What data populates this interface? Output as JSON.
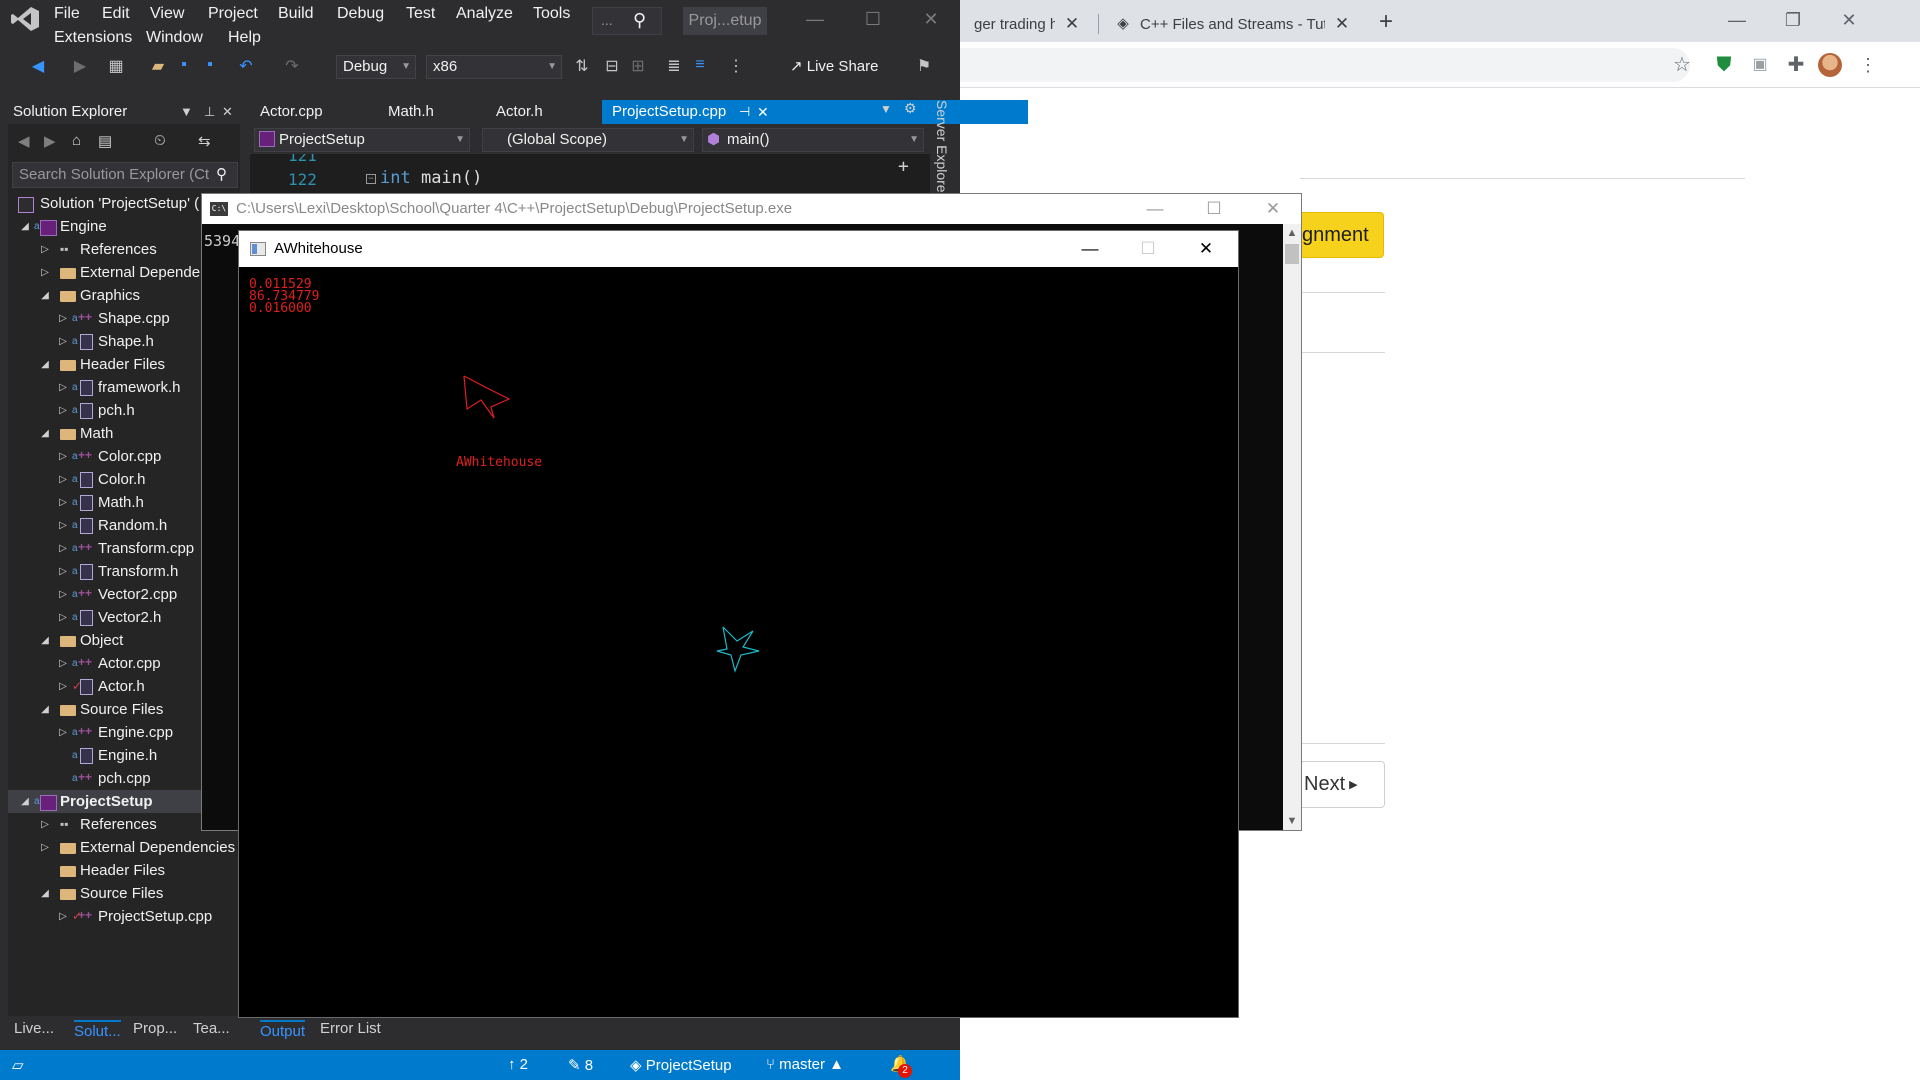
{
  "browser": {
    "tabs": [
      {
        "title": "ger trading ha",
        "close": "✕"
      },
      {
        "title": "C++ Files and Streams - Tutorials",
        "close": "✕"
      }
    ],
    "new_tab": "+",
    "page": {
      "assignment_button": "gnment",
      "next_button": "Next"
    }
  },
  "vs": {
    "menu": [
      "File",
      "Edit",
      "View",
      "Project",
      "Build",
      "Debug",
      "Test",
      "Analyze",
      "Tools",
      "Extensions",
      "Window",
      "Help"
    ],
    "search_placeholder": "...",
    "project_title": "Proj...etup",
    "toolbar": {
      "configuration": "Debug",
      "platform": "x86",
      "live_share": "Live Share"
    },
    "solution_explorer": {
      "title": "Solution Explorer",
      "search_placeholder": "Search Solution Explorer (Ct",
      "solution_label": "Solution 'ProjectSetup' (",
      "tree": [
        {
          "label": "Engine",
          "level": 1,
          "kind": "project",
          "expanded": true
        },
        {
          "label": "References",
          "level": 2,
          "kind": "ref",
          "expanded": false
        },
        {
          "label": "External Depende",
          "level": 2,
          "kind": "folder",
          "expanded": false
        },
        {
          "label": "Graphics",
          "level": 2,
          "kind": "folder",
          "expanded": true
        },
        {
          "label": "Shape.cpp",
          "level": 3,
          "kind": "cpp",
          "expanded": false
        },
        {
          "label": "Shape.h",
          "level": 3,
          "kind": "h",
          "expanded": false
        },
        {
          "label": "Header Files",
          "level": 2,
          "kind": "folder",
          "expanded": true
        },
        {
          "label": "framework.h",
          "level": 3,
          "kind": "h",
          "expanded": false
        },
        {
          "label": "pch.h",
          "level": 3,
          "kind": "h",
          "expanded": false
        },
        {
          "label": "Math",
          "level": 2,
          "kind": "folder",
          "expanded": true
        },
        {
          "label": "Color.cpp",
          "level": 3,
          "kind": "cpp",
          "expanded": false
        },
        {
          "label": "Color.h",
          "level": 3,
          "kind": "h",
          "expanded": false
        },
        {
          "label": "Math.h",
          "level": 3,
          "kind": "h",
          "expanded": false
        },
        {
          "label": "Random.h",
          "level": 3,
          "kind": "h",
          "expanded": false
        },
        {
          "label": "Transform.cpp",
          "level": 3,
          "kind": "cpp",
          "expanded": false
        },
        {
          "label": "Transform.h",
          "level": 3,
          "kind": "h",
          "expanded": false
        },
        {
          "label": "Vector2.cpp",
          "level": 3,
          "kind": "cpp",
          "expanded": false
        },
        {
          "label": "Vector2.h",
          "level": 3,
          "kind": "h",
          "expanded": false
        },
        {
          "label": "Object",
          "level": 2,
          "kind": "folder",
          "expanded": true
        },
        {
          "label": "Actor.cpp",
          "level": 3,
          "kind": "cpp",
          "expanded": false
        },
        {
          "label": "Actor.h",
          "level": 3,
          "kind": "h",
          "expanded": false
        },
        {
          "label": "Source Files",
          "level": 2,
          "kind": "folder",
          "expanded": true
        },
        {
          "label": "Engine.cpp",
          "level": 3,
          "kind": "cpp",
          "expanded": false
        },
        {
          "label": "Engine.h",
          "level": 3,
          "kind": "h",
          "leaf": true
        },
        {
          "label": "pch.cpp",
          "level": 3,
          "kind": "cpp",
          "leaf": true
        },
        {
          "label": "ProjectSetup",
          "level": 1,
          "kind": "project",
          "expanded": true,
          "selected": true
        },
        {
          "label": "References",
          "level": 2,
          "kind": "ref",
          "expanded": false
        },
        {
          "label": "External Dependencies",
          "level": 2,
          "kind": "folder",
          "expanded": false
        },
        {
          "label": "Header Files",
          "level": 2,
          "kind": "folder",
          "leaf": true
        },
        {
          "label": "Source Files",
          "level": 2,
          "kind": "folder",
          "expanded": true
        },
        {
          "label": "ProjectSetup.cpp",
          "level": 3,
          "kind": "cpp",
          "expanded": false
        }
      ],
      "bottom_tabs": [
        "Live...",
        "Solut...",
        "Prop...",
        "Tea..."
      ]
    },
    "editor": {
      "tabs": [
        "Actor.cpp",
        "Math.h",
        "Actor.h",
        "ProjectSetup.cpp"
      ],
      "active_tab": "ProjectSetup.cpp",
      "nav_project": "ProjectSetup",
      "nav_scope": "(Global Scope)",
      "nav_function": "main()",
      "lines": [
        {
          "number": "121",
          "code": ""
        },
        {
          "number": "122",
          "keyword": "int",
          "code": " main()"
        }
      ],
      "server_explorer": "Server Explorer"
    },
    "output_tabs": [
      "Output",
      "Error List"
    ],
    "status": {
      "up_count": "2",
      "edit_count": "8",
      "project": "ProjectSetup",
      "branch": "master",
      "notifications": "2"
    }
  },
  "console": {
    "title": "C:\\Users\\Lexi\\Desktop\\School\\Quarter 4\\C++\\ProjectSetup\\Debug\\ProjectSetup.exe",
    "text": "5394"
  },
  "game": {
    "title": "AWhitehouse",
    "stats": [
      "0.011529",
      "86.734779",
      "0.016000"
    ],
    "player_label": "AWhitehouse",
    "colors": {
      "player": "#e01f1f",
      "enemy": "#1fb8c8",
      "background": "#000000"
    }
  },
  "icons": {
    "close": "✕",
    "minimize": "—",
    "maximize": "☐"
  }
}
